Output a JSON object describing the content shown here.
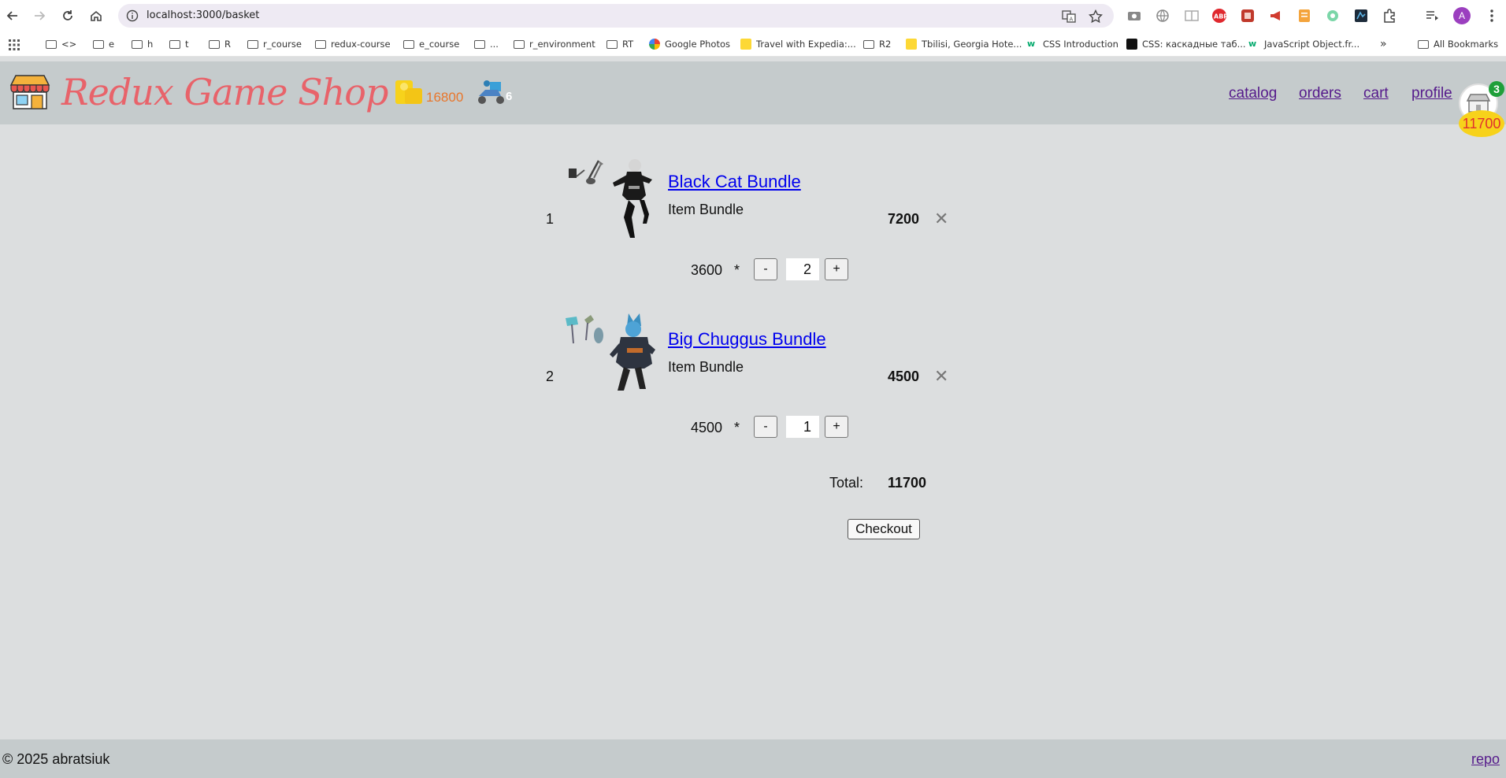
{
  "browser": {
    "url": "localhost:3000/basket",
    "bookmarks": [
      {
        "label": "<>",
        "kind": "folder"
      },
      {
        "label": "e",
        "kind": "folder"
      },
      {
        "label": "h",
        "kind": "folder"
      },
      {
        "label": "t",
        "kind": "folder"
      },
      {
        "label": "R",
        "kind": "folder"
      },
      {
        "label": "r_course",
        "kind": "folder"
      },
      {
        "label": "redux-course",
        "kind": "folder"
      },
      {
        "label": "e_course",
        "kind": "folder"
      },
      {
        "label": "...",
        "kind": "folder"
      },
      {
        "label": "r_environment",
        "kind": "folder"
      },
      {
        "label": "RT",
        "kind": "folder"
      },
      {
        "label": "Google Photos",
        "kind": "site"
      },
      {
        "label": "Travel with Expedia:...",
        "kind": "site"
      },
      {
        "label": "R2",
        "kind": "folder"
      },
      {
        "label": "Tbilisi, Georgia Hote...",
        "kind": "site"
      },
      {
        "label": "CSS Introduction",
        "kind": "site"
      },
      {
        "label": "CSS: каскадные таб...",
        "kind": "site"
      },
      {
        "label": "JavaScript Object.fr...",
        "kind": "site"
      }
    ],
    "more_bookmarks": "»",
    "all_bookmarks": "All Bookmarks",
    "profile_initial": "A"
  },
  "header": {
    "title": "Redux Game Shop",
    "coins": "16800",
    "delivery_count": "6",
    "nav": {
      "catalog": "catalog",
      "orders": "orders",
      "cart": "cart",
      "profile": "profile"
    },
    "cart_count": "3",
    "cart_total": "11700"
  },
  "basket": {
    "items": [
      {
        "index": "1",
        "title": "Black Cat Bundle",
        "type": "Item Bundle",
        "sum": "7200",
        "unit_price": "3600",
        "multiply": "*",
        "minus": "-",
        "quantity": "2",
        "plus": "+",
        "remove": "✕"
      },
      {
        "index": "2",
        "title": "Big Chuggus Bundle",
        "type": "Item Bundle",
        "sum": "4500",
        "unit_price": "4500",
        "multiply": "*",
        "minus": "-",
        "quantity": "1",
        "plus": "+",
        "remove": "✕"
      }
    ],
    "total_label": "Total:",
    "total_value": "11700",
    "checkout_label": "Checkout"
  },
  "footer": {
    "copyright": "© 2025 abratsiuk",
    "repo": "repo"
  },
  "colors": {
    "page_bg": "#dcdedf",
    "header_bg": "#c5cbcc",
    "title": "#e8636a",
    "coins_text": "#e8762b",
    "link_visited": "#551a8b",
    "link": "#0000ee",
    "badge_green": "#1f9f3a",
    "pill_yellow": "#f7d21b"
  }
}
